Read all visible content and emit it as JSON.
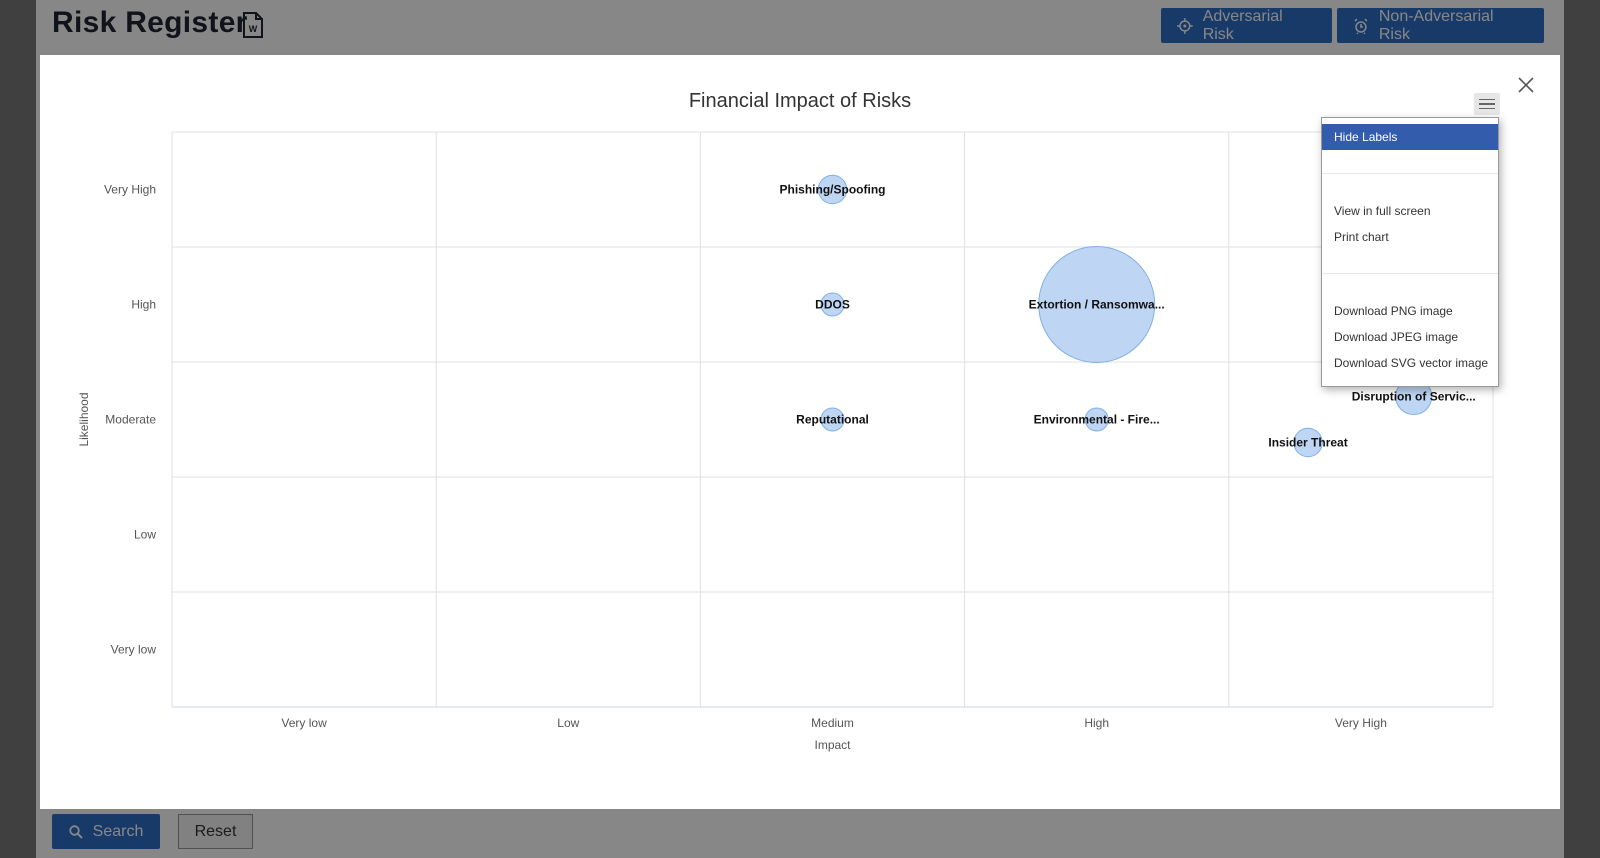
{
  "page": {
    "title": "Risk Register",
    "doc_icon": "word-document-icon",
    "buttons": {
      "adversarial": "Adversarial Risk",
      "non_adversarial": "Non-Adversarial Risk",
      "search": "Search",
      "reset": "Reset"
    },
    "accent": "#2e6fc4"
  },
  "modal": {
    "close_icon": "close-icon",
    "menu_icon": "hamburger-menu-icon",
    "context_menu": {
      "items": [
        "Hide Labels",
        "View in full screen",
        "Print chart",
        "Download PNG image",
        "Download JPEG image",
        "Download SVG vector image"
      ],
      "active": "Hide Labels"
    }
  },
  "chart_data": {
    "type": "scatter",
    "title": "Financial Impact of Risks",
    "xlabel": "Impact",
    "ylabel": "Likelihood",
    "x_categories": [
      "Very low",
      "Low",
      "Medium",
      "High",
      "Very High"
    ],
    "y_categories": [
      "Very low",
      "Low",
      "Moderate",
      "High",
      "Very High"
    ],
    "grid": true,
    "bubble_color": "#a8c8ef",
    "points": [
      {
        "label": "Phishing/Spoofing",
        "x": 2,
        "y": 4,
        "size": 1
      },
      {
        "label": "DDOS",
        "x": 2,
        "y": 3,
        "size": 0.5
      },
      {
        "label": "Extortion / Ransomwa...",
        "x": 3,
        "y": 3,
        "size": 10
      },
      {
        "label": "Reputational",
        "x": 2,
        "y": 2,
        "size": 0.5
      },
      {
        "label": "Environmental - Fire...",
        "x": 3,
        "y": 2,
        "size": 0.5
      },
      {
        "label": "Disruption of Servic...",
        "x": 4.2,
        "y": 2.2,
        "size": 2
      },
      {
        "label": "Insider Threat",
        "x": 3.8,
        "y": 1.8,
        "size": 1
      }
    ]
  }
}
